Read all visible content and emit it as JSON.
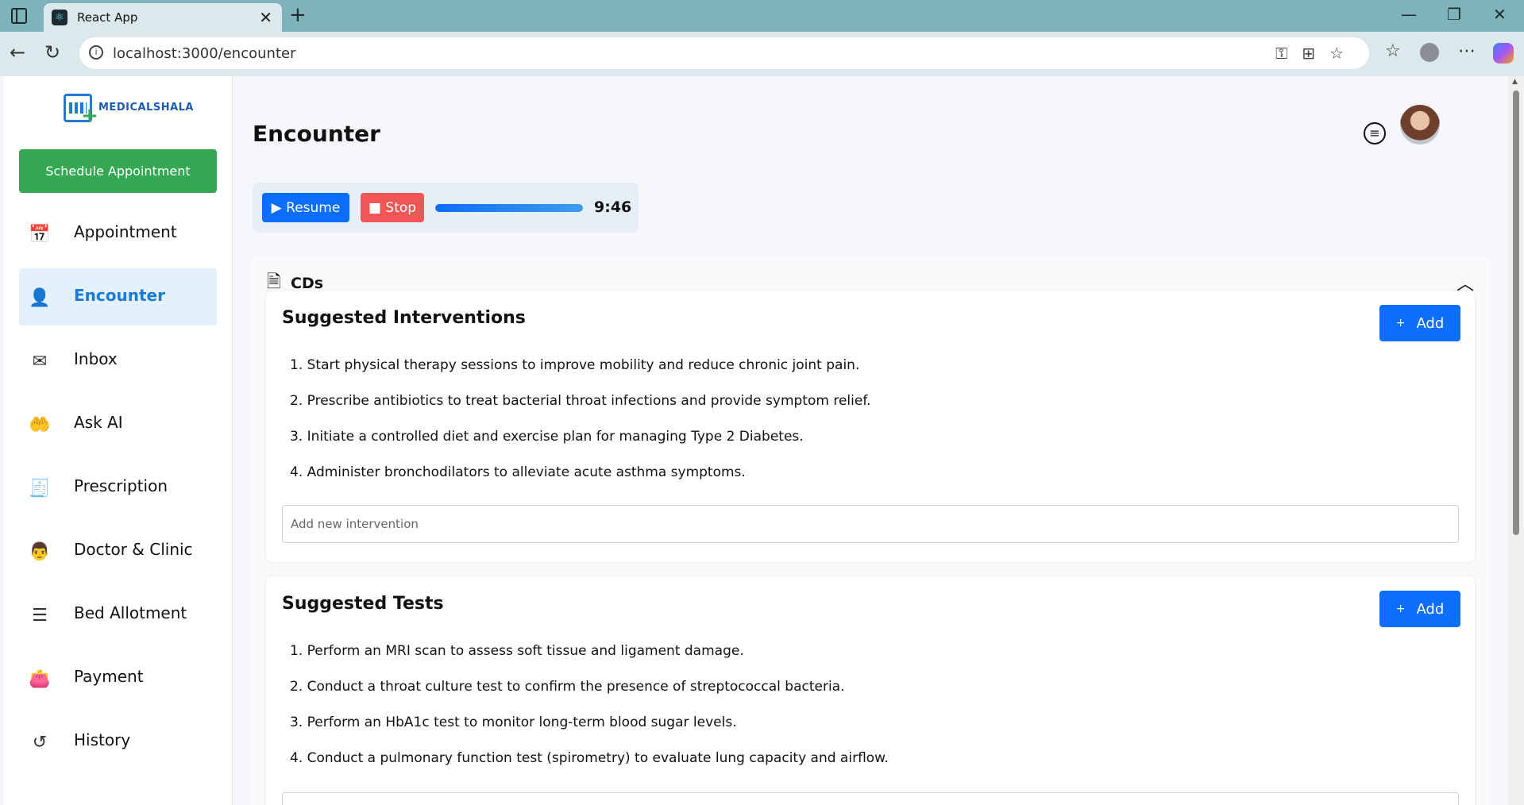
{
  "browser": {
    "tab_title": "React App",
    "tab_close": "✕",
    "new_tab": "+",
    "url": "localhost:3000/encounter",
    "window": {
      "minimize": "—",
      "restore": "❐",
      "close": "✕"
    }
  },
  "sidebar": {
    "logo_text": "MEDICALSHALA",
    "schedule_label": "Schedule Appointment",
    "items": [
      {
        "label": "Appointment",
        "icon": "calendar-icon",
        "glyph": "📅"
      },
      {
        "label": "Encounter",
        "icon": "encounter-icon",
        "glyph": "👤"
      },
      {
        "label": "Inbox",
        "icon": "mail-icon",
        "glyph": "✉"
      },
      {
        "label": "Ask AI",
        "icon": "ai-hand-icon",
        "glyph": "🤲"
      },
      {
        "label": "Prescription",
        "icon": "prescription-icon",
        "glyph": "🧾"
      },
      {
        "label": "Doctor & Clinic",
        "icon": "doctor-icon",
        "glyph": "👨"
      },
      {
        "label": "Bed Allotment",
        "icon": "bed-list-icon",
        "glyph": "☰"
      },
      {
        "label": "Payment",
        "icon": "wallet-icon",
        "glyph": "👛"
      },
      {
        "label": "History",
        "icon": "history-icon",
        "glyph": "↺"
      }
    ],
    "active_index": 1
  },
  "header": {
    "title": "Encounter"
  },
  "recorder": {
    "resume_label": "▶ Resume",
    "stop_label": "■ Stop",
    "progress": 1.0,
    "time": "9:46"
  },
  "cds": {
    "title": "CDs",
    "interventions": {
      "title": "Suggested Interventions",
      "add_label": "Add",
      "items": [
        "1. Start physical therapy sessions to improve mobility and reduce chronic joint pain.",
        "2. Prescribe antibiotics to treat bacterial throat infections and provide symptom relief.",
        "3. Initiate a controlled diet and exercise plan for managing Type 2 Diabetes.",
        "4. Administer bronchodilators to alleviate acute asthma symptoms."
      ],
      "input_placeholder": "Add new intervention"
    },
    "tests": {
      "title": "Suggested Tests",
      "add_label": "Add",
      "items": [
        "1. Perform an MRI scan to assess soft tissue and ligament damage.",
        "2. Conduct a throat culture test to confirm the presence of streptococcal bacteria.",
        "3. Perform an HbA1c test to monitor long-term blood sugar levels.",
        "4. Conduct a pulmonary function test (spirometry) to evaluate lung capacity and airflow."
      ]
    }
  },
  "colors": {
    "primary": "#0d6efd",
    "success": "#34a853",
    "danger": "#f05656",
    "active_bg": "#e3f1fd"
  }
}
